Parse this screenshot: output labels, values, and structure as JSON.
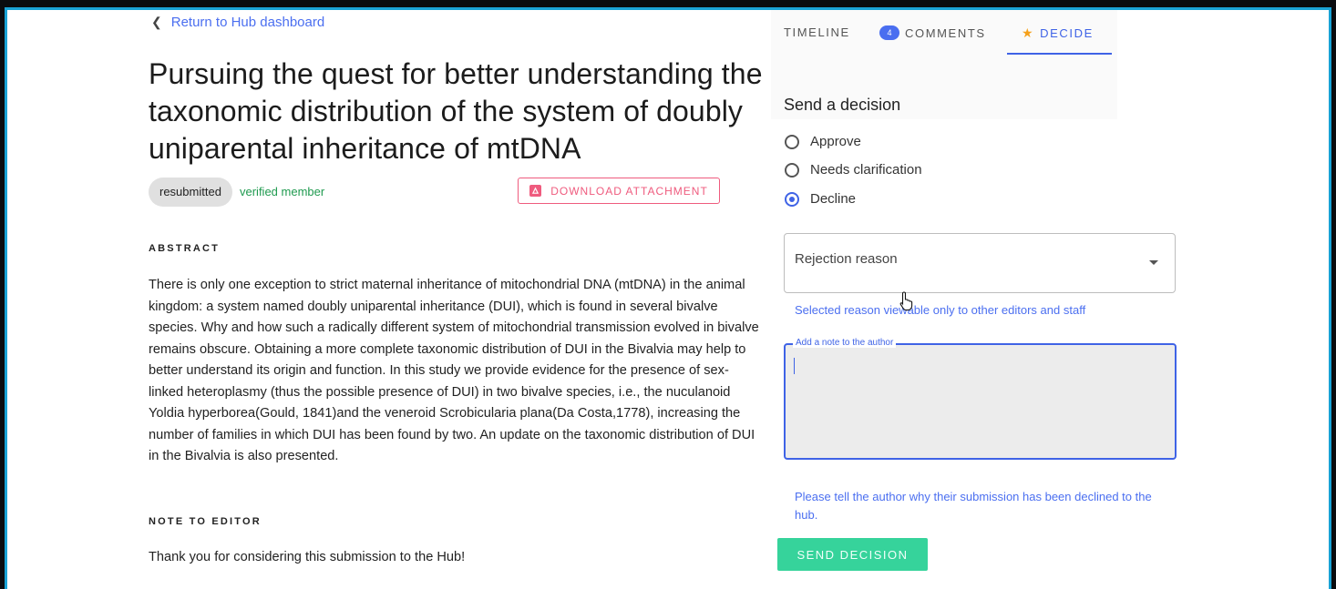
{
  "nav": {
    "back_label": "Return to Hub dashboard"
  },
  "submission": {
    "title": "Pursuing the quest for better understanding the taxonomic distribution of the system of doubly uniparental inheritance of mtDNA",
    "status": "resubmitted",
    "author_status": "verified member",
    "download_label": "DOWNLOAD ATTACHMENT",
    "abstract_heading": "ABSTRACT",
    "abstract": "There is only one exception to strict maternal inheritance of mitochondrial DNA (mtDNA) in the animal kingdom: a system named doubly uniparental inheritance (DUI), which is found in several bivalve species. Why and how such a radically different system of mitochondrial transmission evolved in bivalve remains obscure. Obtaining a more complete taxonomic distribution of DUI in the Bivalvia may help to better understand its origin and function. In this study we provide evidence for the presence of sex-linked heteroplasmy (thus the possible presence of DUI) in two bivalve species, i.e., the nuculanoid Yoldia hyperborea(Gould, 1841)and the veneroid Scrobicularia plana(Da Costa,1778), increasing the number of families in which DUI has been found by two. An update on the taxonomic distribution of DUI in the Bivalvia is also presented.",
    "note_heading": "NOTE TO EDITOR",
    "note": "Thank you for considering this submission to the Hub!"
  },
  "tabs": {
    "timeline": "TIMELINE",
    "comments": "COMMENTS",
    "comments_count": "4",
    "decide": "DECIDE",
    "active": "DECIDE"
  },
  "decision": {
    "heading": "Send a decision",
    "options": [
      {
        "label": "Approve",
        "checked": false
      },
      {
        "label": "Needs clarification",
        "checked": false
      },
      {
        "label": "Decline",
        "checked": true
      }
    ],
    "reason_label": "Rejection reason",
    "reason_helper": "Selected reason viewable only to other editors and staff",
    "note_label": "Add a note to the author",
    "note_value": "",
    "note_helper": "Please tell the author why their submission has been declined to the hub.",
    "send_label": "SEND DECISION"
  },
  "colors": {
    "accent": "#3f63e6",
    "link": "#4b6ff0",
    "verified": "#1f9a4f",
    "download": "#ef5b7e",
    "send": "#36d39b",
    "star": "#f5a01a",
    "frame": "#1aa3d6"
  },
  "icons": {
    "back": "chevron-left-icon",
    "download": "pdf-icon",
    "decide_tab": "star-icon",
    "select": "caret-down-icon",
    "cursor": "hand-pointer-icon"
  }
}
